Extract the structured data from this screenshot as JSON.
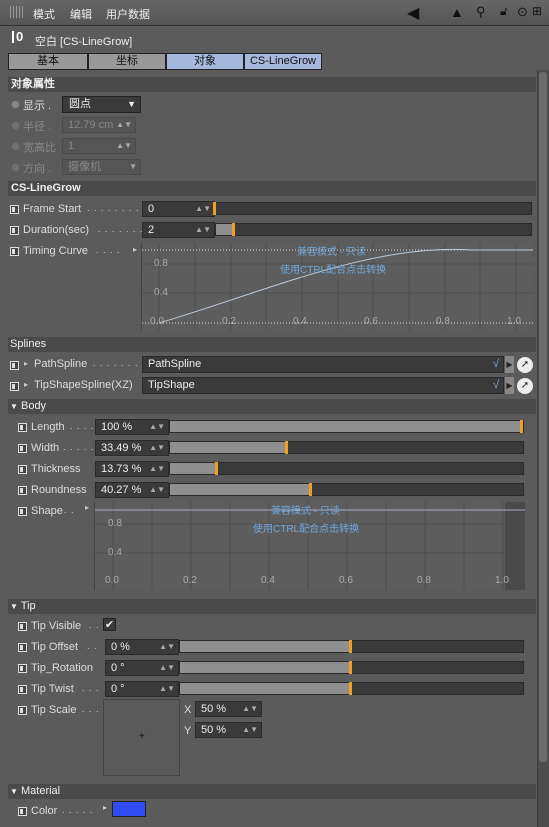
{
  "menu": {
    "items": [
      "模式",
      "编辑",
      "用户数据"
    ]
  },
  "header": {
    "object_title": "空白 [CS-LineGrow]"
  },
  "tabs": [
    {
      "label": "基本",
      "selected": false
    },
    {
      "label": "坐标",
      "selected": false
    },
    {
      "label": "对象",
      "selected": true
    },
    {
      "label": "CS-LineGrow",
      "selected": true
    }
  ],
  "object_props": {
    "title": "对象属性",
    "display": {
      "label": "显示 .",
      "value": "圆点"
    },
    "radius": {
      "label": "半径 .",
      "value": "12.79 cm"
    },
    "aspect": {
      "label": "宽高比",
      "value": "1"
    },
    "orientation": {
      "label": "方向 .",
      "value": "摄像机"
    }
  },
  "cs_linegrow": {
    "title": "CS-LineGrow",
    "frame_start": {
      "label": "Frame Start",
      "dots": ". . . . . . . . .",
      "value": "0",
      "level": 0.0
    },
    "duration": {
      "label": "Duration(sec)",
      "dots": ". . . . . . .",
      "value": "2",
      "level": 0.06
    },
    "timing_curve": {
      "label": "Timing Curve",
      "dots": ". . . .",
      "overlay1": "兼容模式 - 只读",
      "overlay2": "使用CTRL配合点击转换",
      "y_ticks": [
        "0.8",
        "0.4"
      ],
      "x_ticks": [
        "0.0",
        "0.2",
        "0.4",
        "0.6",
        "0.8",
        "1.0"
      ]
    }
  },
  "splines": {
    "title": "Splines",
    "path": {
      "label": "PathSpline",
      "dots": ". . . . . . . .",
      "value": "PathSpline"
    },
    "tipshape": {
      "label": "TipShapeSpline(XZ)",
      "value": "TipShape"
    }
  },
  "body": {
    "title": "Body",
    "length": {
      "label": "Length",
      "dots": ". . . .",
      "value": "100 %",
      "level": 1.0
    },
    "width": {
      "label": "Width",
      "dots": ". . . . .",
      "value": "33.49 %",
      "level": 0.3349
    },
    "thickness": {
      "label": "Thickness",
      "value": "13.73 %",
      "level": 0.1373
    },
    "roundness": {
      "label": "Roundness",
      "value": "40.27 %",
      "level": 0.4027
    },
    "shape": {
      "label": "Shape",
      "dots": ". .",
      "overlay1": "兼容模式 - 只读",
      "overlay2": "使用CTRL配合点击转换",
      "y_ticks": [
        "0.8",
        "0.4"
      ],
      "x_ticks": [
        "0.0",
        "0.2",
        "0.4",
        "0.6",
        "0.8",
        "1.0"
      ]
    }
  },
  "tip": {
    "title": "Tip",
    "visible": {
      "label": "Tip Visible",
      "dots": ". .",
      "check": "✔"
    },
    "offset": {
      "label": "Tip Offset",
      "dots": ". .",
      "value": "0 %",
      "level": 0.5
    },
    "rotation": {
      "label": "Tip_Rotation",
      "value": "0 °",
      "level": 0.5
    },
    "twist": {
      "label": "Tip Twist",
      "dots": ". . .",
      "value": "0 °",
      "level": 0.5
    },
    "scale": {
      "label": "Tip Scale",
      "dots": ". . .",
      "x_label": "X",
      "x_value": "50 %",
      "y_label": "Y",
      "y_value": "50 %"
    }
  },
  "material": {
    "title": "Material",
    "color": {
      "label": "Color",
      "dots": ". . . . .",
      "swatch": "#2f4cf2"
    }
  },
  "colors": {
    "accent": "#f0a020",
    "tab_selected": "#a6b8dc",
    "overlay_text": "#6fa8dc"
  }
}
